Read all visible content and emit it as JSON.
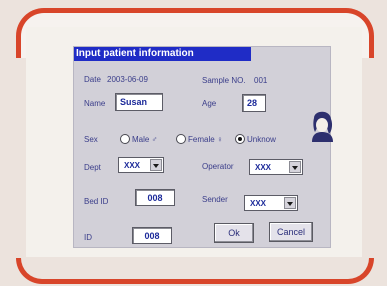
{
  "dialog": {
    "title": "Input patient information",
    "date_label": "Date",
    "date_value": "2003-06-09",
    "sample_label": "Sample NO.",
    "sample_value": "001",
    "name_label": "Name",
    "name_value": "Susan",
    "age_label": "Age",
    "age_value": "28",
    "sex_label": "Sex",
    "sex_options": [
      "Male ♂",
      "Female ♀",
      "Unknow"
    ],
    "sex_selected": "Unknow",
    "dept_label": "Dept",
    "dept_value": "XXX",
    "operator_label": "Operator",
    "operator_value": "XXX",
    "bed_label": "Bed ID",
    "bed_value": "008",
    "sender_label": "Sender",
    "sender_value": "XXX",
    "id_label": "ID",
    "id_value": "008",
    "ok_label": "Ok",
    "cancel_label": "Cancel"
  },
  "colors": {
    "frame_accent": "#d8452a",
    "titlebar": "#1f2cc6",
    "dialog_bg": "#d2d0d8",
    "label_text": "#3a3d8a"
  },
  "icons": [
    "female-avatar-icon",
    "dropdown-arrow-icon"
  ]
}
